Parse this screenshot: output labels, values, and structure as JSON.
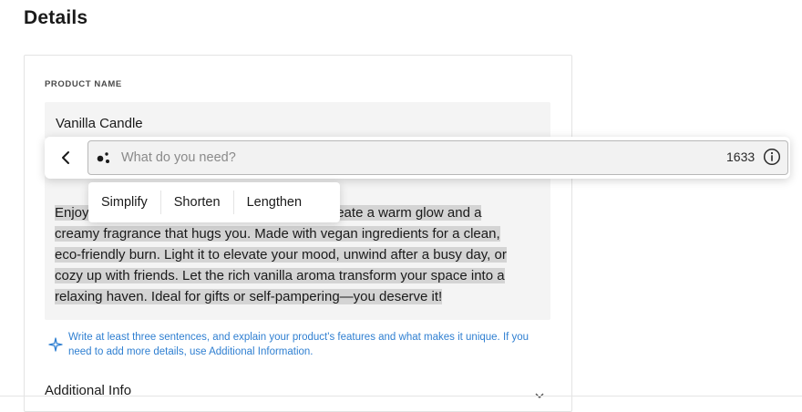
{
  "page": {
    "title": "Details"
  },
  "product_name": {
    "label": "PRODUCT NAME",
    "value": "Vanilla Candle"
  },
  "description": {
    "hidden_start": "Enjoy",
    "visible_tail": "e to create a warm glow and a",
    "lines": [
      "creamy fragrance that hugs you. Made with vegan ingredients for a clean,",
      "eco-friendly burn. Light it to elevate your mood, unwind after a busy day, or",
      "cozy up with friends. Let the rich vanilla aroma transform your space into a",
      "relaxing haven. Ideal for gifts or self-pampering—you deserve it!"
    ]
  },
  "hint": {
    "text": "Write at least three sentences, and explain your product's features and what makes it unique. If you need to add more details, use Additional Information.",
    "icon": "sparkle-icon",
    "color": "#2f7fd1"
  },
  "additional_info": {
    "label": "Additional Info"
  },
  "ai_assist": {
    "placeholder": "What do you need?",
    "count": "1633",
    "back_icon": "chevron-left-icon",
    "ai_icon": "ai-dots-icon",
    "info_icon": "info-icon"
  },
  "suggestions": [
    "Simplify",
    "Shorten",
    "Lengthen"
  ]
}
